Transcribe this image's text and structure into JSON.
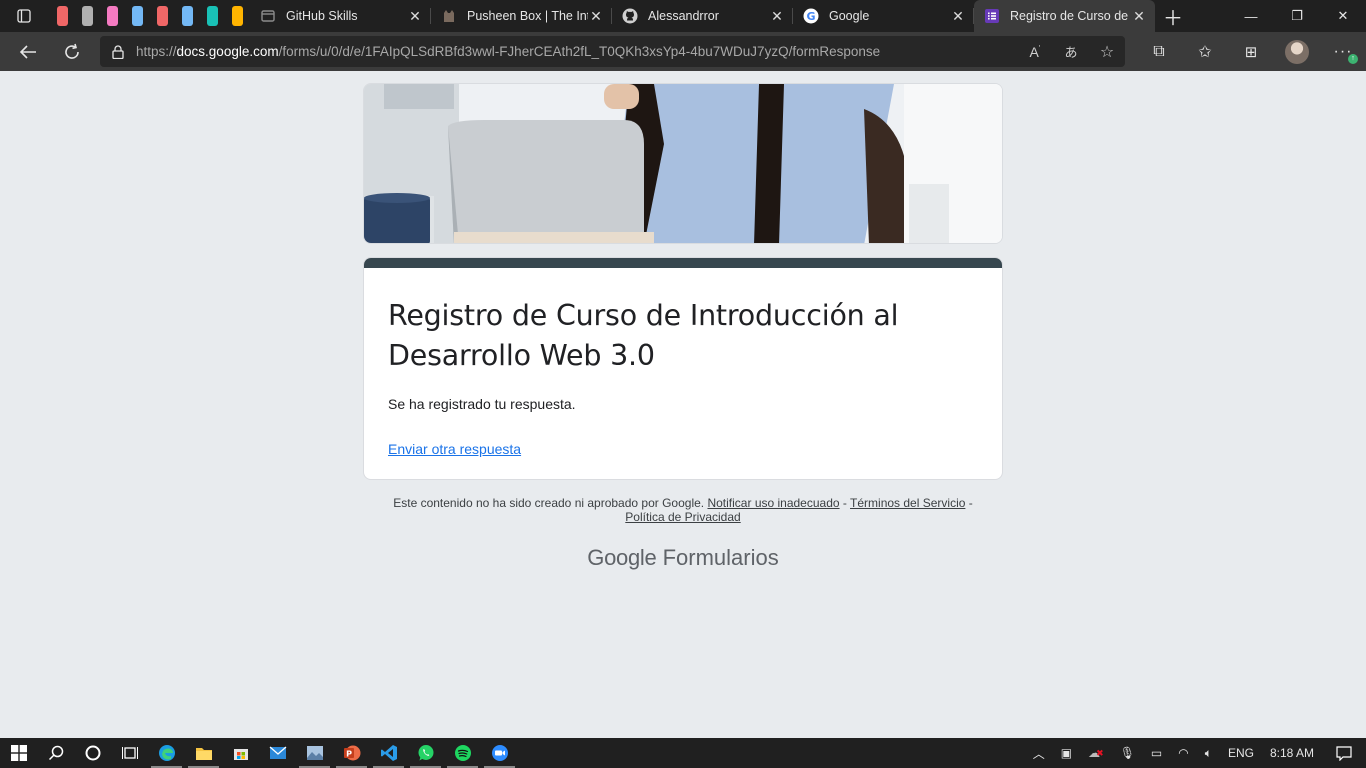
{
  "browser": {
    "pinned_colors": [
      "#f06767",
      "#b0b0b0",
      "#f47ac1",
      "#73b8f5",
      "#f06767",
      "#73b8f5",
      "#19c1b6",
      "#ffb400"
    ],
    "tabs": [
      {
        "title": "GitHub Skills",
        "icon": "github-skills-icon",
        "active": false
      },
      {
        "title": "Pusheen Box | The Inte",
        "icon": "pusheen-icon",
        "active": false
      },
      {
        "title": "Alessandrror",
        "icon": "github-icon",
        "active": false
      },
      {
        "title": "Google",
        "icon": "google-icon",
        "active": false
      },
      {
        "title": "Registro de Curso de I",
        "icon": "google-forms-icon",
        "active": true
      }
    ],
    "url_prefix": "https://",
    "url_domain": "docs.google.com",
    "url_path": "/forms/u/0/d/e/1FAIpQLSdRBfd3wwl-FJherCEAth2fL_T0QKh3xsYp4-4bu7WDuJ7yzQ/formResponse",
    "accent": "#3b3b3b"
  },
  "form": {
    "title": "Registro de Curso de Introducción al Desarrollo Web 3.0",
    "message": "Se ha registrado tu respuesta.",
    "resend_link": "Enviar otra respuesta",
    "header_color": "#37474f",
    "link_color": "#1a73e8"
  },
  "footer": {
    "disclaimer": "Este contenido no ha sido creado ni aprobado por Google.",
    "report": "Notificar uso inadecuado",
    "sep": "-",
    "terms": "Términos del Servicio",
    "privacy": "Política de Privacidad",
    "brand_google": "Google",
    "brand_product": "Formularios"
  },
  "taskbar": {
    "lang": "ENG",
    "time": "8:18 AM"
  }
}
